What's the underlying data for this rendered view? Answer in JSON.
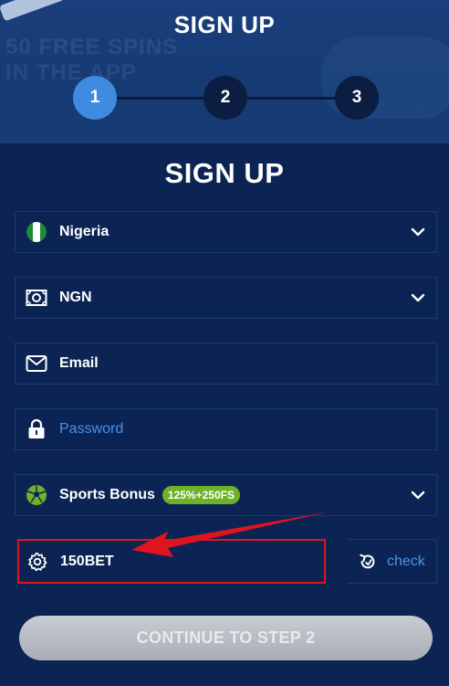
{
  "banner": {
    "title": "SIGN UP",
    "background_text": "50 FREE SPINS\nIN THE APP"
  },
  "steps": [
    {
      "label": "1",
      "state": "active"
    },
    {
      "label": "2",
      "state": "inactive"
    },
    {
      "label": "3",
      "state": "inactive"
    }
  ],
  "form": {
    "title": "SIGN UP",
    "country": {
      "value": "Nigeria",
      "icon": "nigeria-flag-icon"
    },
    "currency": {
      "value": "NGN",
      "icon": "banknote-icon"
    },
    "email": {
      "placeholder": "Email",
      "icon": "envelope-icon"
    },
    "password": {
      "placeholder": "Password",
      "icon": "lock-icon"
    },
    "bonus": {
      "value": "Sports Bonus",
      "badge": "125%+250FS",
      "icon": "soccer-ball-icon"
    },
    "promo": {
      "value": "150BET",
      "icon": "gear-icon"
    },
    "check": {
      "label": "check",
      "icon": "refresh-icon"
    },
    "continue_label": "CONTINUE TO STEP 2"
  },
  "colors": {
    "background": "#0b2453",
    "accent_blue": "#3f8be0",
    "badge_green": "#6fb229",
    "highlight_red": "#e0141e"
  }
}
